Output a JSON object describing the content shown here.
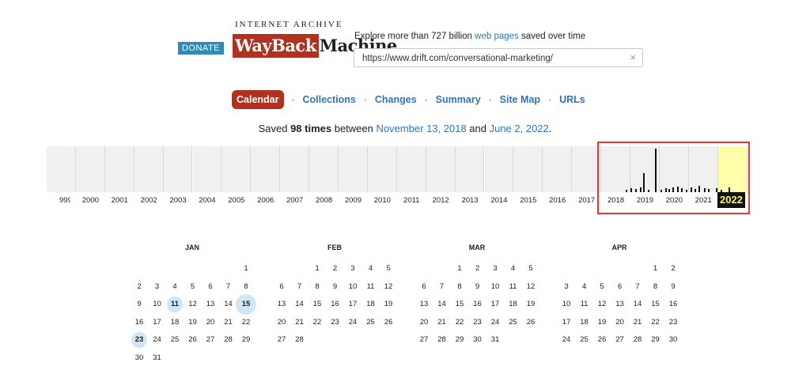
{
  "header": {
    "donate_label": "DONATE",
    "logo_top": "INTERNET ARCHIVE",
    "logo_wayback": "WaybackMachine",
    "logo_wb": "WayBack",
    "logo_machine": "Machine",
    "tagline_prefix": "Explore more than 727 billion ",
    "tagline_link": "web pages",
    "tagline_suffix": " saved over time",
    "url_value": "https://www.drift.com/conversational-marketing/",
    "clear_icon": "×"
  },
  "nav": {
    "items": [
      "Calendar",
      "Collections",
      "Changes",
      "Summary",
      "Site Map",
      "URLs"
    ],
    "active": "Calendar",
    "separator": "·"
  },
  "saved": {
    "prefix": "Saved ",
    "count": "98 times",
    "between": " between ",
    "start": "November 13, 2018",
    "and": " and ",
    "end": "June 2, 2022",
    "period": "."
  },
  "timeline": {
    "years": [
      "999",
      "2000",
      "2001",
      "2002",
      "2003",
      "2004",
      "2005",
      "2006",
      "2007",
      "2008",
      "2009",
      "2010",
      "2011",
      "2012",
      "2013",
      "2014",
      "2015",
      "2016",
      "2017",
      "2018",
      "2019",
      "2020",
      "2021"
    ],
    "selected_year": "2022"
  },
  "calendar": {
    "months": [
      {
        "name": "JAN",
        "first_weekday": 6,
        "days": 31,
        "snapshots": [
          11,
          15,
          23
        ],
        "big": [
          15
        ]
      },
      {
        "name": "FEB",
        "first_weekday": 2,
        "days": 28,
        "snapshots": [],
        "big": []
      },
      {
        "name": "MAR",
        "first_weekday": 2,
        "days": 31,
        "snapshots": [],
        "big": []
      },
      {
        "name": "APR",
        "first_weekday": 5,
        "days": 30,
        "snapshots": [],
        "big": []
      }
    ]
  }
}
